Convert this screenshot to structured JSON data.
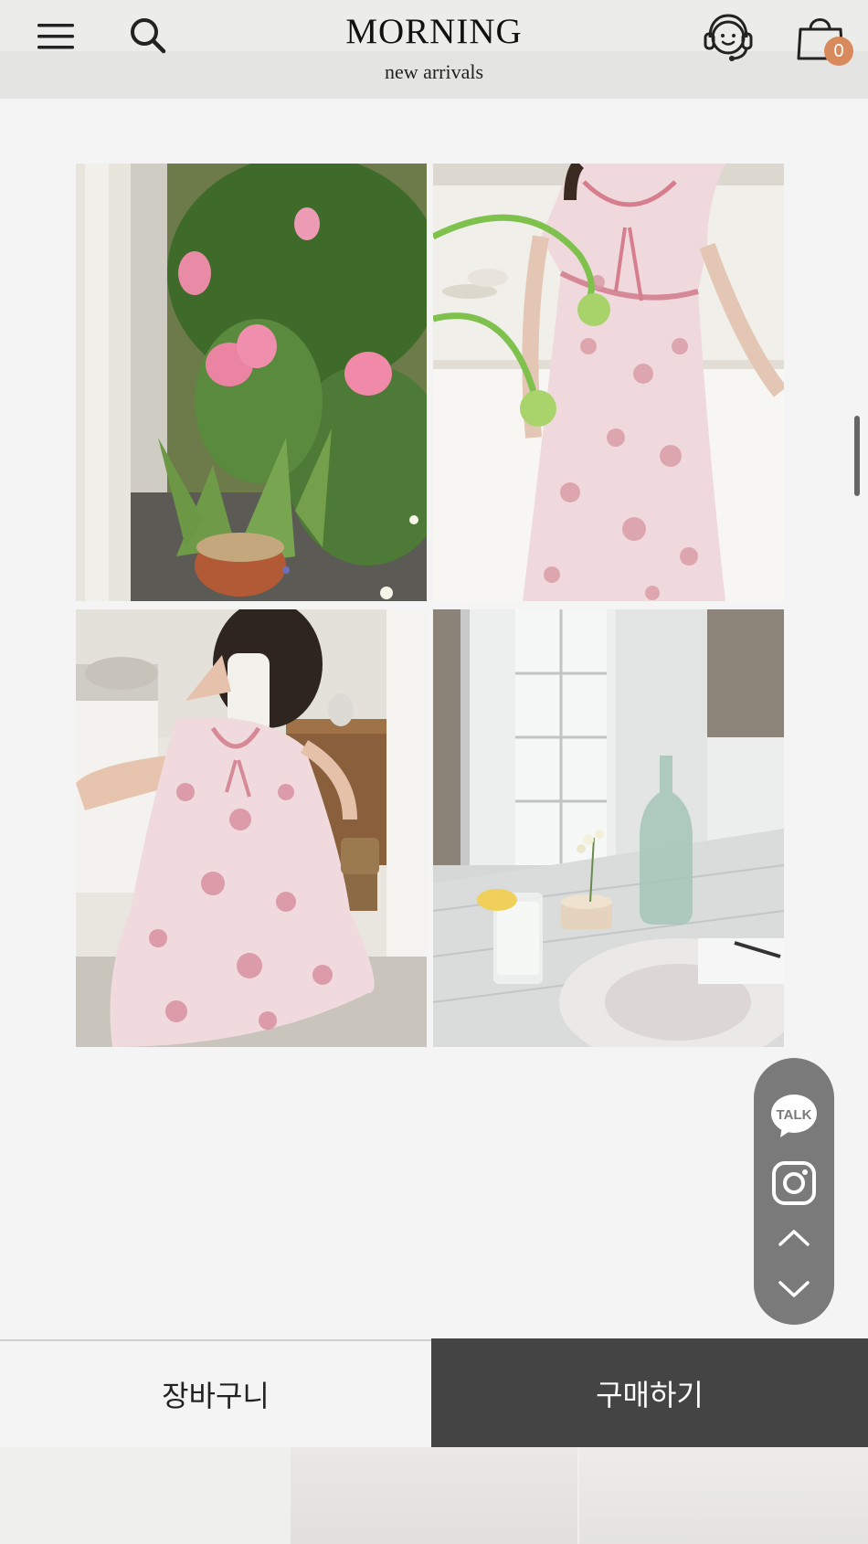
{
  "header": {
    "brand": "MORNING",
    "subtitle": "new arrivals",
    "cart_count": "0"
  },
  "gallery": {
    "photos": [
      {
        "subject": "pink tulips in pots with greenery"
      },
      {
        "subject": "model in pink floral dress holding a green stem"
      },
      {
        "subject": "model crouching taking mirror selfie in floral dress"
      },
      {
        "subject": "table with lemon water glass, flowers and glass bottle"
      }
    ]
  },
  "quick_menu": {
    "talk_label": "TALK",
    "items": [
      "talk-icon",
      "instagram-icon",
      "chevron-up-icon",
      "chevron-down-icon"
    ]
  },
  "bottom_bar": {
    "cart_label": "장바구니",
    "buy_label": "구매하기"
  },
  "colors": {
    "badge": "#d88a5c",
    "buy_button": "#444444",
    "quick_menu": "#7a7a7a",
    "page_bg": "#f4f4f5"
  }
}
